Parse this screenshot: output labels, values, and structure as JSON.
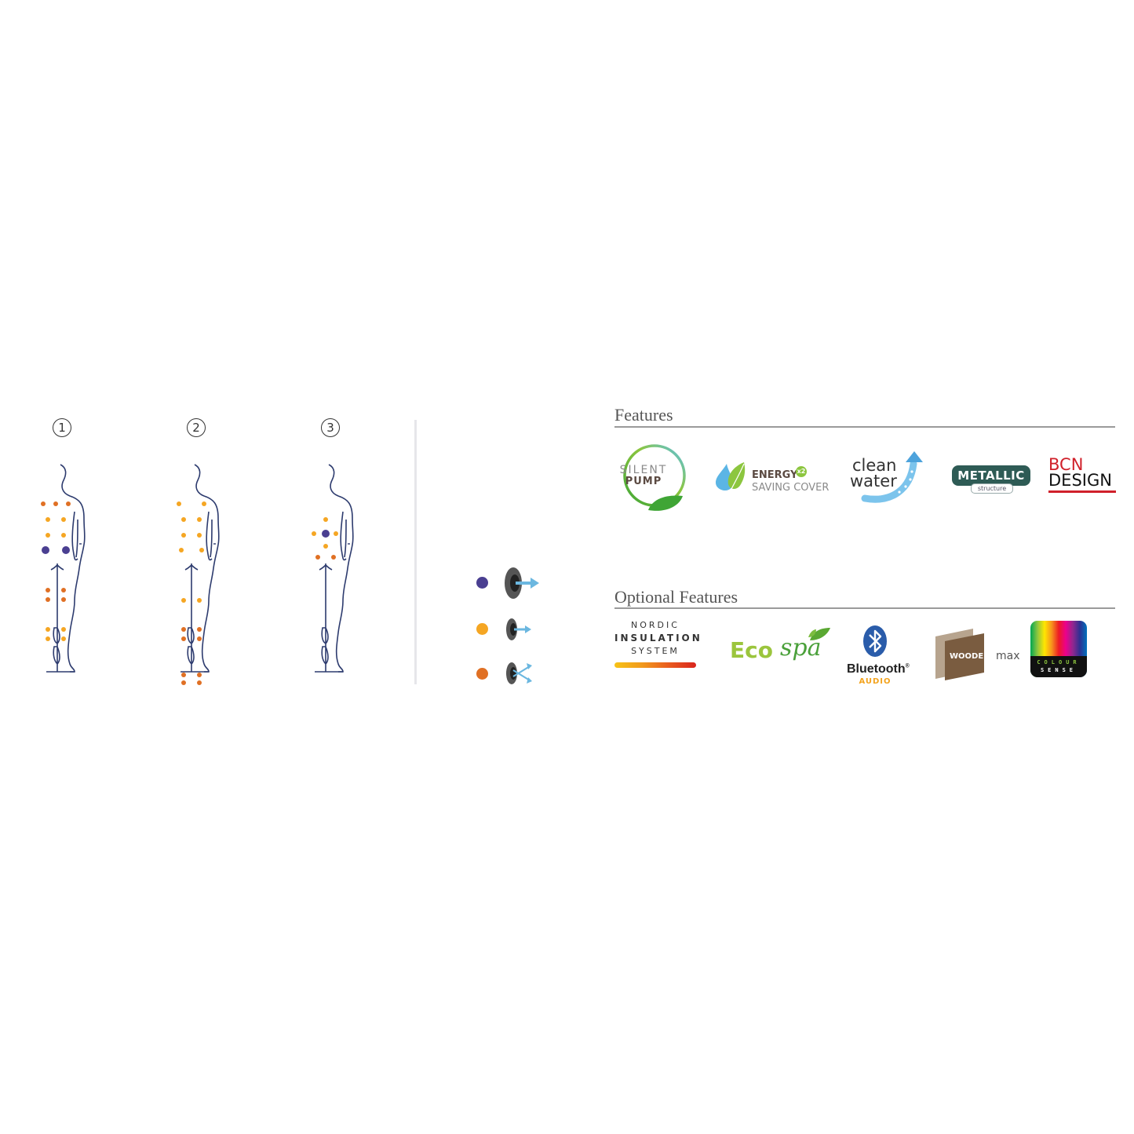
{
  "positions": [
    {
      "number": "1"
    },
    {
      "number": "2"
    },
    {
      "number": "3"
    }
  ],
  "colors": {
    "body_outline": "#2d3b6e",
    "jet_large": "#4a3f91",
    "jet_medium": "#f5a623",
    "jet_massage": "#e07024",
    "divider": "#e6e6ea",
    "section_rule": "#9a9a9a",
    "section_title": "#555555"
  },
  "legend": [
    {
      "jet": "large-jet",
      "color": "#4a3f91",
      "icon": "single-arrow-jet-icon"
    },
    {
      "jet": "medium-jet",
      "color": "#f5a623",
      "icon": "small-arrow-jet-icon"
    },
    {
      "jet": "massage-jet",
      "color": "#e07024",
      "icon": "crossing-arrows-jet-icon"
    }
  ],
  "features": {
    "title": "Features",
    "items": [
      {
        "name": "silent-pump",
        "line1": "SILENT",
        "line2": "PUMP"
      },
      {
        "name": "energy-saving-cover",
        "line1": "ENERGY",
        "badge": "x2",
        "line2": "SAVING COVER"
      },
      {
        "name": "clean-water",
        "line1": "clean",
        "line2": "water"
      },
      {
        "name": "metallic-structure",
        "line1": "METALLIC",
        "line2": "structure"
      },
      {
        "name": "bcn-design",
        "line1": "BCN",
        "line2": "DESIGN"
      }
    ]
  },
  "optional_features": {
    "title": "Optional Features",
    "items": [
      {
        "name": "nordic-insulation-system",
        "line1": "NORDIC",
        "line2": "INSULATION",
        "line3": "SYSTEM"
      },
      {
        "name": "ecospa",
        "line1": "Eco",
        "line2": "spa"
      },
      {
        "name": "bluetooth-audio",
        "line1": "Bluetooth",
        "reg": "®",
        "line2": "AUDIO"
      },
      {
        "name": "woodermax",
        "line1": "WOODER",
        "line2": "max"
      },
      {
        "name": "colour-sense",
        "line1": "COLOUR",
        "line2": "SENSE"
      }
    ]
  }
}
